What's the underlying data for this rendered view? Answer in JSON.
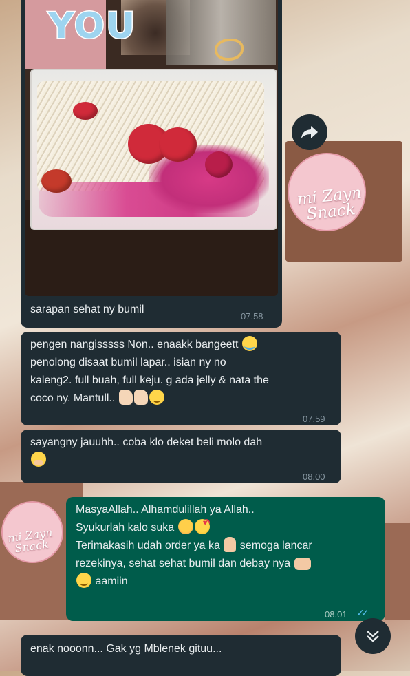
{
  "sticker": {
    "text": "YOU"
  },
  "background": {
    "product_label_large": "mi Zayn Snack",
    "product_label_small": "mi Zayn Snack"
  },
  "messages": [
    {
      "id": "image",
      "type": "incoming-image",
      "caption": "sarapan sehat ny bumil",
      "time": "07.58"
    },
    {
      "id": "m1",
      "type": "incoming",
      "lines": [
        "pengen nangisssss Non.. enaakk bangeett",
        "penolong disaat bumil lapar.. isian ny no",
        "kaleng2. full buah, full keju. g ada jelly & nata the",
        "coco ny. Mantull.."
      ],
      "emojis": [
        "loudly-crying-face",
        "thumbs-up",
        "thumbs-up",
        "relieved-face"
      ],
      "time": "07.59"
    },
    {
      "id": "m2",
      "type": "incoming",
      "lines": [
        "sayangny jauuhh.. coba klo deket beli molo dah"
      ],
      "emojis": [
        "face-with-hand-over-mouth"
      ],
      "time": "08.00"
    },
    {
      "id": "m3",
      "type": "outgoing",
      "lines": [
        "MasyaAllah.. Alhamdulillah ya Allah..",
        "Syukurlah kalo suka",
        "Terimakasih udah order ya ka",
        "semoga lancar",
        "rezekinya, sehat sehat bumil dan debay nya",
        "aamiin"
      ],
      "emojis": [
        "flushed-face",
        "smiling-face-with-hearts",
        "folded-hands",
        "palms-up-together",
        "smiling-face"
      ],
      "time": "08.01",
      "status": "read"
    },
    {
      "id": "m4",
      "type": "incoming",
      "lines": [
        "enak nooonn... Gak yg Mblenek gituu..."
      ]
    }
  ],
  "buttons": {
    "forward": "forward-icon",
    "scroll_down": "chevron-down-icon"
  },
  "colors": {
    "incoming_bubble": "#1f2c33",
    "outgoing_bubble": "#005c4b",
    "read_ticks": "#53bdeb",
    "timestamp": "#8696a0"
  }
}
